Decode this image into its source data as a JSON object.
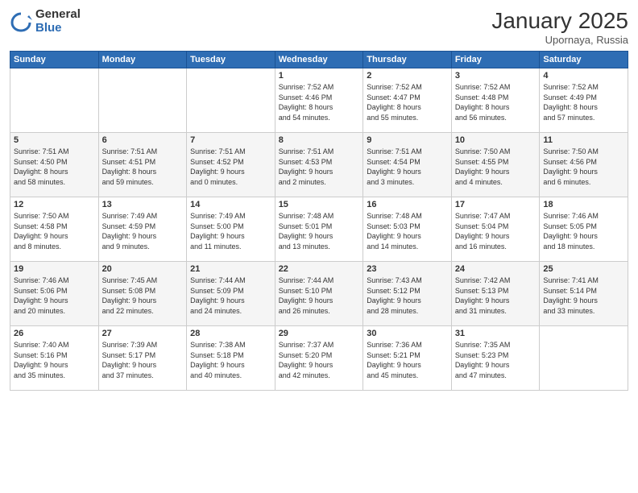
{
  "logo": {
    "general": "General",
    "blue": "Blue"
  },
  "header": {
    "month": "January 2025",
    "location": "Upornaya, Russia"
  },
  "weekdays": [
    "Sunday",
    "Monday",
    "Tuesday",
    "Wednesday",
    "Thursday",
    "Friday",
    "Saturday"
  ],
  "weeks": [
    [
      {
        "day": "",
        "info": ""
      },
      {
        "day": "",
        "info": ""
      },
      {
        "day": "",
        "info": ""
      },
      {
        "day": "1",
        "info": "Sunrise: 7:52 AM\nSunset: 4:46 PM\nDaylight: 8 hours\nand 54 minutes."
      },
      {
        "day": "2",
        "info": "Sunrise: 7:52 AM\nSunset: 4:47 PM\nDaylight: 8 hours\nand 55 minutes."
      },
      {
        "day": "3",
        "info": "Sunrise: 7:52 AM\nSunset: 4:48 PM\nDaylight: 8 hours\nand 56 minutes."
      },
      {
        "day": "4",
        "info": "Sunrise: 7:52 AM\nSunset: 4:49 PM\nDaylight: 8 hours\nand 57 minutes."
      }
    ],
    [
      {
        "day": "5",
        "info": "Sunrise: 7:51 AM\nSunset: 4:50 PM\nDaylight: 8 hours\nand 58 minutes."
      },
      {
        "day": "6",
        "info": "Sunrise: 7:51 AM\nSunset: 4:51 PM\nDaylight: 8 hours\nand 59 minutes."
      },
      {
        "day": "7",
        "info": "Sunrise: 7:51 AM\nSunset: 4:52 PM\nDaylight: 9 hours\nand 0 minutes."
      },
      {
        "day": "8",
        "info": "Sunrise: 7:51 AM\nSunset: 4:53 PM\nDaylight: 9 hours\nand 2 minutes."
      },
      {
        "day": "9",
        "info": "Sunrise: 7:51 AM\nSunset: 4:54 PM\nDaylight: 9 hours\nand 3 minutes."
      },
      {
        "day": "10",
        "info": "Sunrise: 7:50 AM\nSunset: 4:55 PM\nDaylight: 9 hours\nand 4 minutes."
      },
      {
        "day": "11",
        "info": "Sunrise: 7:50 AM\nSunset: 4:56 PM\nDaylight: 9 hours\nand 6 minutes."
      }
    ],
    [
      {
        "day": "12",
        "info": "Sunrise: 7:50 AM\nSunset: 4:58 PM\nDaylight: 9 hours\nand 8 minutes."
      },
      {
        "day": "13",
        "info": "Sunrise: 7:49 AM\nSunset: 4:59 PM\nDaylight: 9 hours\nand 9 minutes."
      },
      {
        "day": "14",
        "info": "Sunrise: 7:49 AM\nSunset: 5:00 PM\nDaylight: 9 hours\nand 11 minutes."
      },
      {
        "day": "15",
        "info": "Sunrise: 7:48 AM\nSunset: 5:01 PM\nDaylight: 9 hours\nand 13 minutes."
      },
      {
        "day": "16",
        "info": "Sunrise: 7:48 AM\nSunset: 5:03 PM\nDaylight: 9 hours\nand 14 minutes."
      },
      {
        "day": "17",
        "info": "Sunrise: 7:47 AM\nSunset: 5:04 PM\nDaylight: 9 hours\nand 16 minutes."
      },
      {
        "day": "18",
        "info": "Sunrise: 7:46 AM\nSunset: 5:05 PM\nDaylight: 9 hours\nand 18 minutes."
      }
    ],
    [
      {
        "day": "19",
        "info": "Sunrise: 7:46 AM\nSunset: 5:06 PM\nDaylight: 9 hours\nand 20 minutes."
      },
      {
        "day": "20",
        "info": "Sunrise: 7:45 AM\nSunset: 5:08 PM\nDaylight: 9 hours\nand 22 minutes."
      },
      {
        "day": "21",
        "info": "Sunrise: 7:44 AM\nSunset: 5:09 PM\nDaylight: 9 hours\nand 24 minutes."
      },
      {
        "day": "22",
        "info": "Sunrise: 7:44 AM\nSunset: 5:10 PM\nDaylight: 9 hours\nand 26 minutes."
      },
      {
        "day": "23",
        "info": "Sunrise: 7:43 AM\nSunset: 5:12 PM\nDaylight: 9 hours\nand 28 minutes."
      },
      {
        "day": "24",
        "info": "Sunrise: 7:42 AM\nSunset: 5:13 PM\nDaylight: 9 hours\nand 31 minutes."
      },
      {
        "day": "25",
        "info": "Sunrise: 7:41 AM\nSunset: 5:14 PM\nDaylight: 9 hours\nand 33 minutes."
      }
    ],
    [
      {
        "day": "26",
        "info": "Sunrise: 7:40 AM\nSunset: 5:16 PM\nDaylight: 9 hours\nand 35 minutes."
      },
      {
        "day": "27",
        "info": "Sunrise: 7:39 AM\nSunset: 5:17 PM\nDaylight: 9 hours\nand 37 minutes."
      },
      {
        "day": "28",
        "info": "Sunrise: 7:38 AM\nSunset: 5:18 PM\nDaylight: 9 hours\nand 40 minutes."
      },
      {
        "day": "29",
        "info": "Sunrise: 7:37 AM\nSunset: 5:20 PM\nDaylight: 9 hours\nand 42 minutes."
      },
      {
        "day": "30",
        "info": "Sunrise: 7:36 AM\nSunset: 5:21 PM\nDaylight: 9 hours\nand 45 minutes."
      },
      {
        "day": "31",
        "info": "Sunrise: 7:35 AM\nSunset: 5:23 PM\nDaylight: 9 hours\nand 47 minutes."
      },
      {
        "day": "",
        "info": ""
      }
    ]
  ]
}
